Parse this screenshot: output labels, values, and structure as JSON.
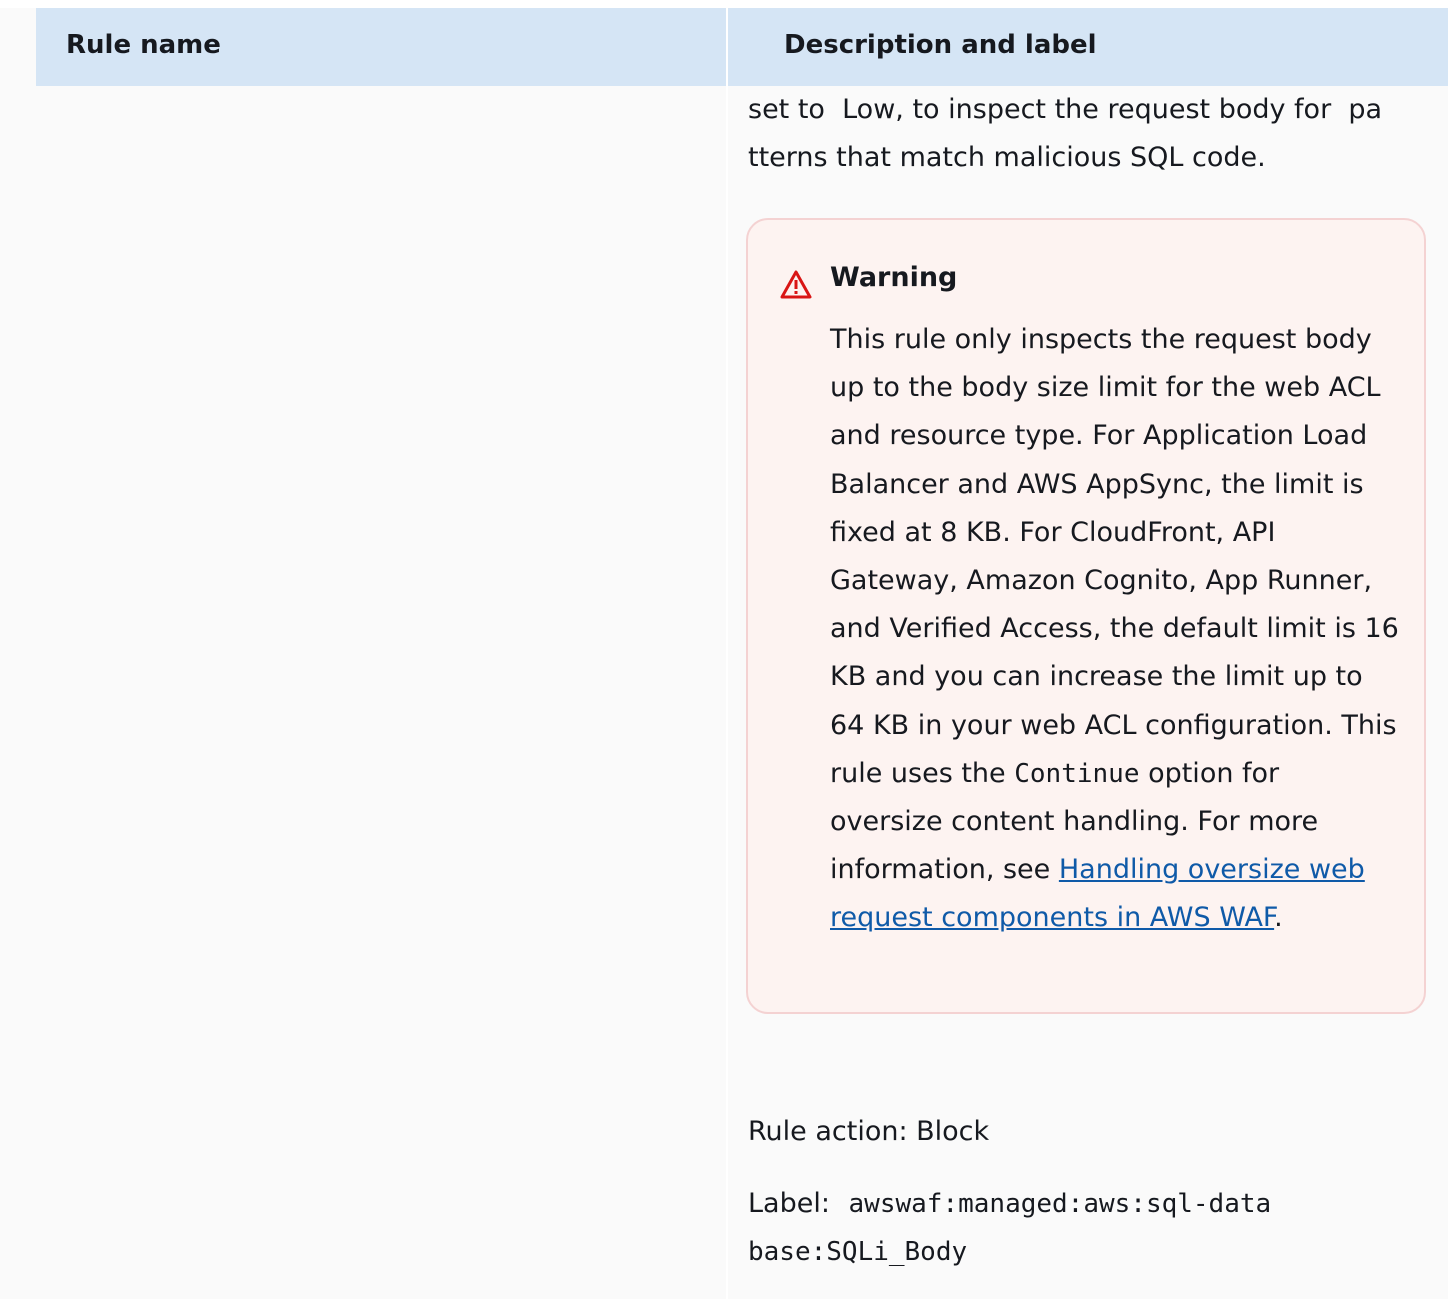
{
  "table": {
    "headers": {
      "rule_name": "Rule name",
      "description": "Description and label"
    }
  },
  "description": {
    "line1": "set to  Low, to inspect the request body for  pa",
    "line2": "tterns that match malicious SQL code."
  },
  "warning": {
    "title": "Warning",
    "text_before_code": "This rule only inspects the request body up to the body size limit for the web ACL and resource type. For Application Load Balancer and AWS AppSync, the limit is fixed at 8 KB. For CloudFront, API Gateway, Amazon Cognito, App Runner, and Verified Access, the default limit is 16 KB and you can increase the limit up to 64 KB in your web ACL configuration. This rule uses the ",
    "code": "Continue",
    "text_after_code": " option for oversize content handling. For more information, see ",
    "link": "Handling oversize web request components in AWS WAF",
    "text_end": ".",
    "icon": "warning-triangle-icon",
    "icon_color": "#d91515"
  },
  "rule_action": "Rule action: Block",
  "label": {
    "prefix": "Label: ",
    "value_line1": "awswaf:managed:aws:sql-data",
    "value_line2": "base:SQLi_Body"
  },
  "colors": {
    "header_bg": "#d5e5f5",
    "row_bg": "#fafafa",
    "warning_bg": "#fdf3f1",
    "warning_border": "#f4d2d2",
    "link": "#0f5aa8"
  }
}
